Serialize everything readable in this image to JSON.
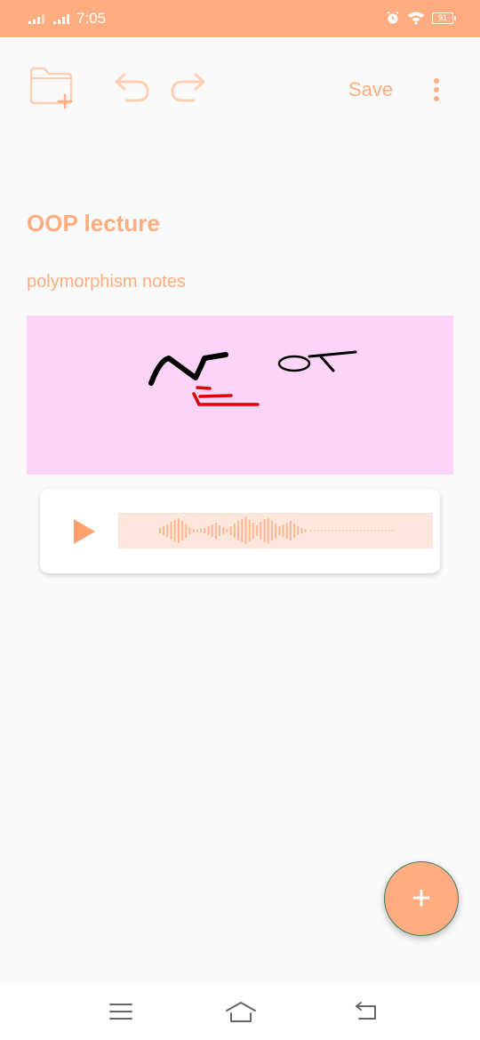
{
  "status_bar": {
    "time": "7:05",
    "battery": "91",
    "icons": [
      "signal-icon",
      "signal-icon",
      "alarm-icon",
      "wifi-icon",
      "battery-icon"
    ]
  },
  "toolbar": {
    "save_label": "Save",
    "icons": [
      "new-folder-icon",
      "undo-icon",
      "redo-icon",
      "more-vert-icon"
    ]
  },
  "note": {
    "title": "OOP lecture",
    "body": "polymorphism notes",
    "drawing_background": "#fcd4f8"
  },
  "audio": {
    "icons": [
      "play-icon",
      "waveform"
    ],
    "progress": 0.45
  },
  "fab": {
    "label": "+",
    "icon": "add-icon"
  },
  "nav_bar": {
    "icons": [
      "menu-icon",
      "home-icon",
      "back-icon"
    ]
  },
  "colors": {
    "accent": "#ffad80",
    "background": "#fafafa",
    "drawing_bg": "#fcd4f8",
    "waveform_bg": "#fde7dc"
  }
}
